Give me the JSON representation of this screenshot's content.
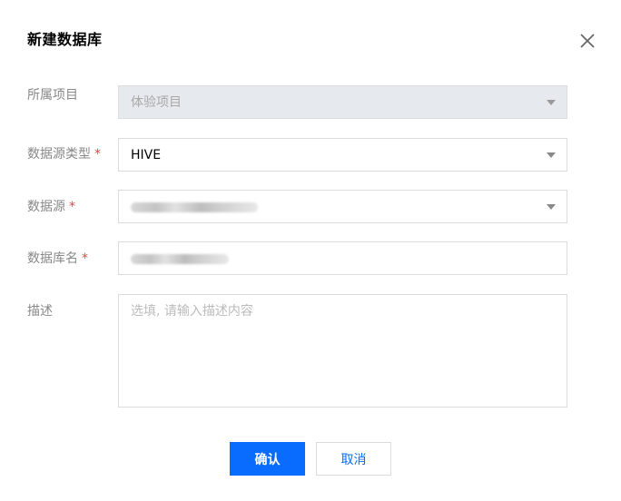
{
  "dialog": {
    "title": "新建数据库",
    "close_icon": "close-icon"
  },
  "form": {
    "project": {
      "label": "所属项目",
      "value": "体验项目",
      "disabled": true
    },
    "source_type": {
      "label": "数据源类型",
      "required_mark": "*",
      "value": "HIVE"
    },
    "source": {
      "label": "数据源",
      "required_mark": "*",
      "value_redacted": true
    },
    "db_name": {
      "label": "数据库名",
      "required_mark": "*",
      "value_redacted": true
    },
    "description": {
      "label": "描述",
      "placeholder": "选填, 请输入描述内容"
    }
  },
  "buttons": {
    "confirm": "确认",
    "cancel": "取消"
  },
  "colors": {
    "primary": "#0a6cff",
    "required": "#e54545",
    "disabled_bg": "#e6e9ee"
  }
}
